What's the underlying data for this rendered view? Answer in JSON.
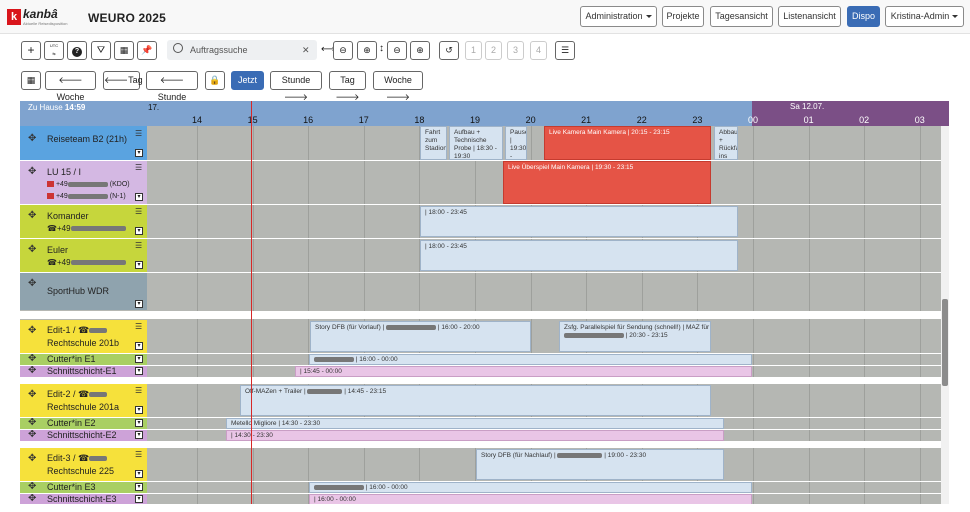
{
  "app": {
    "logo_letter": "k",
    "logo_text": "kanbâ",
    "logo_sub": "Aktuelle Reisedisposition",
    "title": "WEURO 2025"
  },
  "nav": {
    "administration": "Administration",
    "projekte": "Projekte",
    "tagesansicht": "Tagesansicht",
    "listenansicht": "Listenansicht",
    "dispo": "Dispo",
    "user": "Kristina-Admin"
  },
  "toolbar": {
    "add": "+",
    "utc": "UTC",
    "search_placeholder": "Auftragssuche",
    "clear": "✕",
    "days": [
      "1",
      "2",
      "3",
      "4"
    ]
  },
  "navrow": {
    "woche_back": "Woche",
    "tag_back": "Tag",
    "stunde_back": "Stunde",
    "jetzt": "Jetzt",
    "stunde_fwd": "Stunde",
    "tag_fwd": "Tag",
    "woche_fwd": "Woche"
  },
  "timeline": {
    "zuhause_label": "Zu Hause",
    "zuhause_time": "14:59",
    "date_prefix": "17.",
    "hours": [
      "14",
      "15",
      "16",
      "17",
      "18",
      "19",
      "20",
      "21",
      "22",
      "23",
      "00",
      "01",
      "02",
      "03"
    ],
    "next_day": "Sa 12.07."
  },
  "rows": {
    "reiseteam": "Reiseteam B2 (21h)",
    "lu15": "LU 15 / I",
    "lu15_phone1": "+49",
    "lu15_phone1_tag": "(KDO)",
    "lu15_phone2": "+49",
    "lu15_phone2_tag": "(N-1)",
    "komander": "Komander",
    "komander_phone": "+49",
    "euler": "Euler",
    "euler_phone": "+49",
    "sporthub": "SportHub WDR",
    "edit1": "Edit-1 /",
    "edit1_room": "Rechtschule 201b",
    "cutter1": "Cutter*in E1",
    "schnitt1": "Schnittschicht-E1",
    "edit2": "Edit-2 /",
    "edit2_room": "Rechtschule 201a",
    "cutter2": "Cutter*in E2",
    "schnitt2": "Schnittschicht-E2",
    "edit3": "Edit-3 /",
    "edit3_room": "Rechtschule 225",
    "cutter3": "Cutter*in E3",
    "schnitt3": "Schnittschicht-E3"
  },
  "events": {
    "reise_a": "Fahrt zum Stadion",
    "reise_b": "Aufbau + Technische Probe | 18:30 - 19:30",
    "reise_c": "Pause | 19:30 - 20:00",
    "reise_d": "Live Kamera Main Kamera | 20:15 - 23:15",
    "reise_e": "Abbau + Rückfahrt ins Hotel",
    "lu15_live": "Live Überspiel Main Kamera | 19:30 - 23:15",
    "komander_ev": "| 18:00 - 23:45",
    "euler_ev": "| 18:00 - 23:45",
    "edit1_a": "Story DFB (für Vorlauf) |",
    "edit1_a_time": "| 16:00 - 20:00",
    "edit1_b": "Zsfg. Parallelspiel für Sendung (schnell!) | MAZ für",
    "edit1_b_time": "| 20:30 - 23:15",
    "cutter1_ev": "| 16:00 - 00:00",
    "schnitt1_ev": "| 15:45 - 00:00",
    "edit2_ev": "Off-MAZen + Trailer |",
    "edit2_ev_time": "| 14:45 - 23:15",
    "cutter2_ev": "Metello Migliore | 14:30 - 23:30",
    "schnitt2_ev": "| 14:30 - 23:30",
    "edit3_ev": "Story DFB (für Nachlauf) |",
    "edit3_ev_time": "| 19:00 - 23:30",
    "cutter3_ev": "| 16:00 - 00:00",
    "schnitt3_ev": "| 16:00 - 00:00"
  },
  "colors": {
    "reiseteam": "#5aa3e0",
    "lu15": "#d4b8e3",
    "yellow_green": "#c6d63c",
    "sporthub": "#8fa3ae",
    "edit_yellow": "#f6e13b",
    "cutter_green": "#a9cf63",
    "schnitt_purple": "#cda2d8"
  }
}
